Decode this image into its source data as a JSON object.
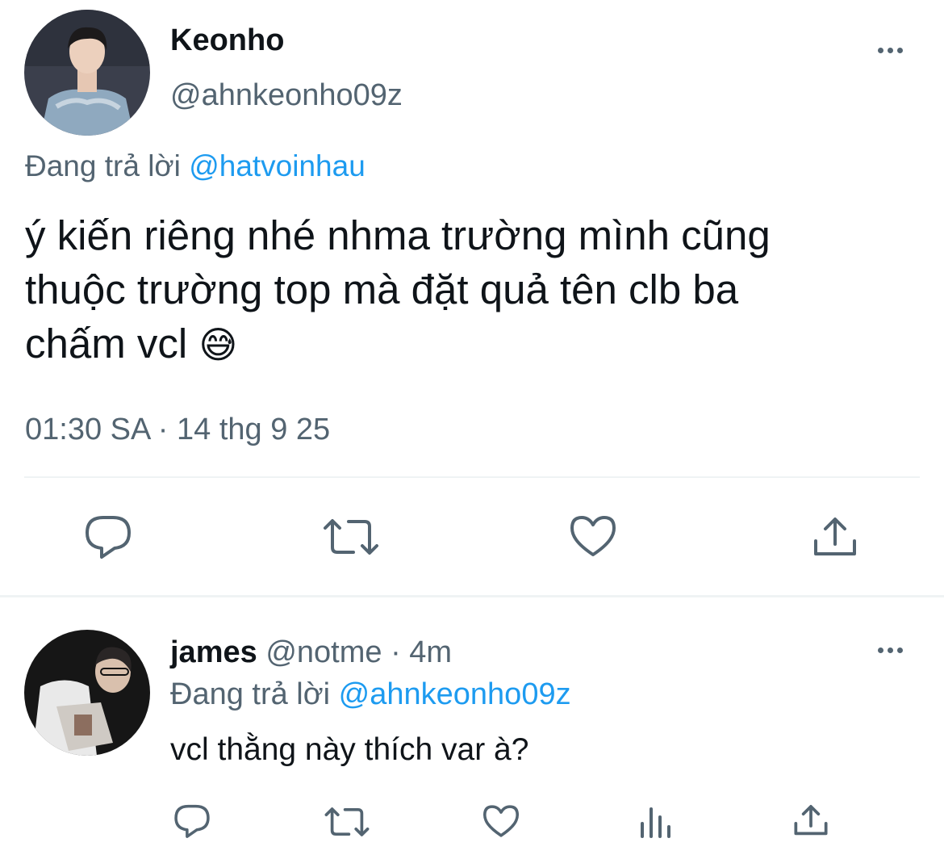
{
  "main_tweet": {
    "display_name": "Keonho",
    "handle": "@ahnkeonho09z",
    "reply_prefix": "Đang trả lời",
    "reply_to": "@hatvoinhau",
    "text_lines": [
      "ý kiến riêng nhé nhma trường mình cũng",
      "thuộc trường top mà đặt quả tên clb ba",
      "chấm vcl"
    ],
    "emoji": "😅",
    "timestamp": "01:30 SA · 14 thg 9 25"
  },
  "reply_tweet": {
    "display_name": "james",
    "handle": "@notme",
    "time_sep": "·",
    "time": "4m",
    "reply_prefix": "Đang trả lời",
    "reply_to": "@ahnkeonho09z",
    "text": "vcl thằng này thích var à?"
  },
  "icons": {
    "more": "more-horizontal-icon",
    "reply": "reply-icon",
    "retweet": "retweet-icon",
    "like": "like-icon",
    "share": "share-icon",
    "analytics": "analytics-icon"
  },
  "colors": {
    "text": "#0f1419",
    "muted": "#536471",
    "link": "#1d9bf0",
    "divider": "#eff3f4"
  }
}
